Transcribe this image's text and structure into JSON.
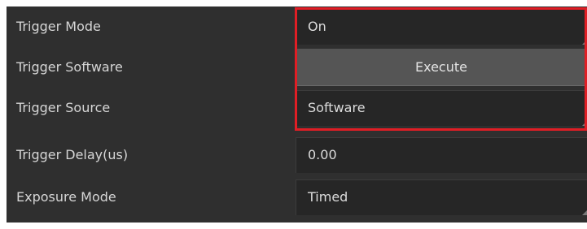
{
  "rows": [
    {
      "label": "Trigger Mode",
      "value": "On",
      "control": "dropdown"
    },
    {
      "label": "Trigger Software",
      "value": "Execute",
      "control": "button"
    },
    {
      "label": "Trigger Source",
      "value": "Software",
      "control": "dropdown"
    },
    {
      "label": "Trigger Delay(us)",
      "value": "0.00",
      "control": "input"
    },
    {
      "label": "Exposure Mode",
      "value": "Timed",
      "control": "dropdown"
    }
  ],
  "highlight_color": "#e01e25",
  "icons": {
    "dropdown": "dropdown-corner-icon"
  }
}
